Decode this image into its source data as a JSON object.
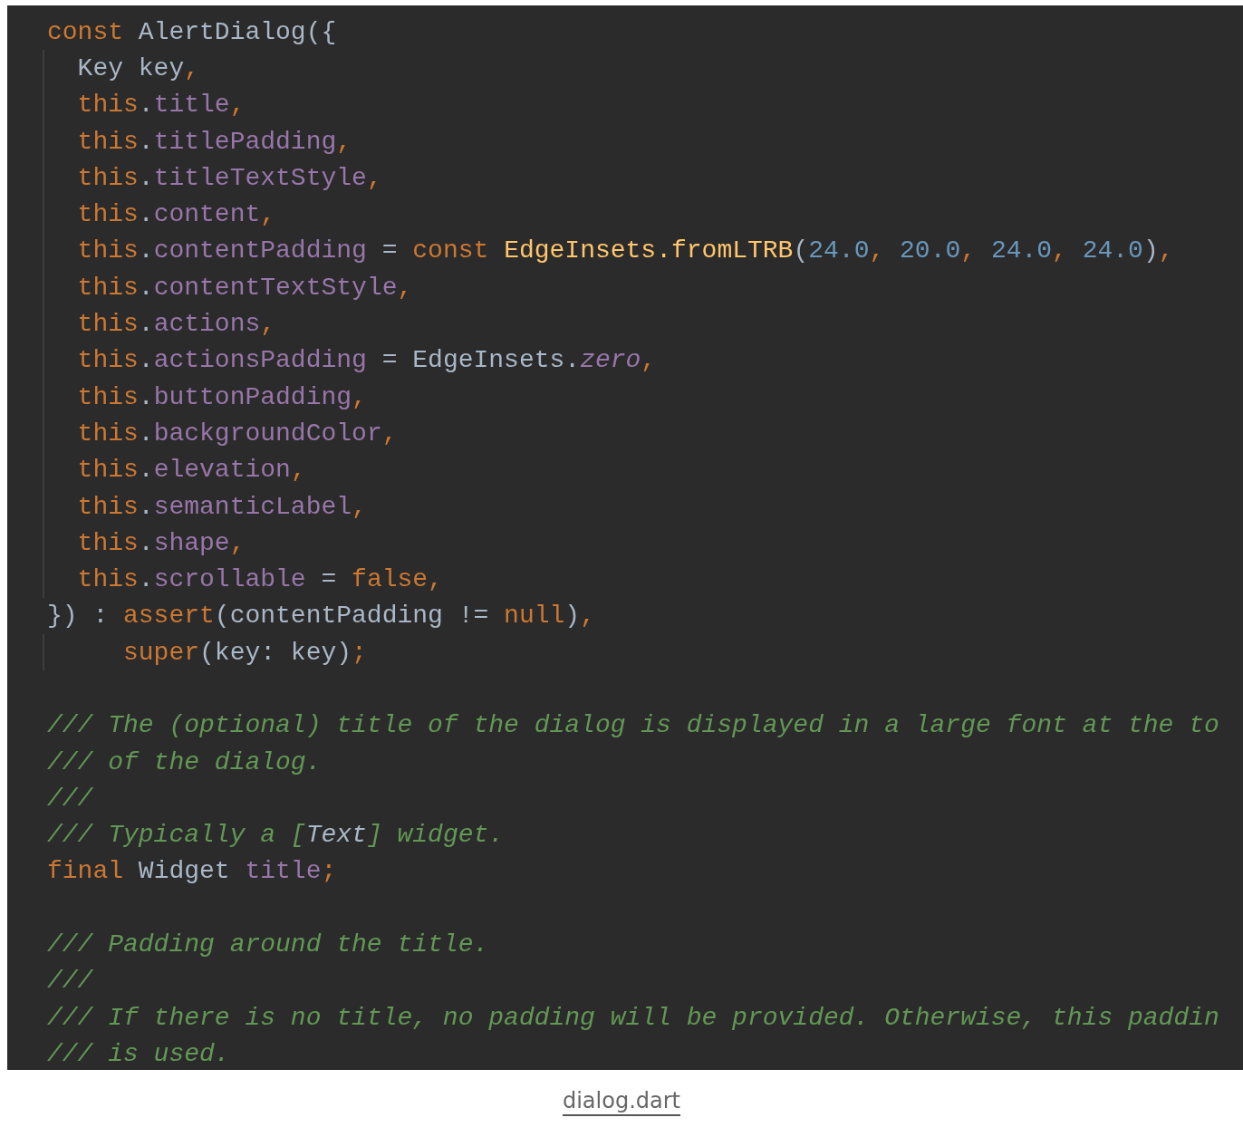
{
  "code_lines": [
    {
      "guide": false,
      "tokens": [
        {
          "kind": "keyword",
          "text": "const "
        },
        {
          "kind": "plain",
          "text": "AlertDialog({"
        }
      ]
    },
    {
      "guide": true,
      "tokens": [
        {
          "kind": "plain",
          "text": "  Key key"
        },
        {
          "kind": "keyword",
          "text": ","
        }
      ]
    },
    {
      "guide": true,
      "tokens": [
        {
          "kind": "keyword",
          "text": "  this"
        },
        {
          "kind": "plain",
          "text": "."
        },
        {
          "kind": "field",
          "text": "title"
        },
        {
          "kind": "keyword",
          "text": ","
        }
      ]
    },
    {
      "guide": true,
      "tokens": [
        {
          "kind": "keyword",
          "text": "  this"
        },
        {
          "kind": "plain",
          "text": "."
        },
        {
          "kind": "field",
          "text": "titlePadding"
        },
        {
          "kind": "keyword",
          "text": ","
        }
      ]
    },
    {
      "guide": true,
      "tokens": [
        {
          "kind": "keyword",
          "text": "  this"
        },
        {
          "kind": "plain",
          "text": "."
        },
        {
          "kind": "field",
          "text": "titleTextStyle"
        },
        {
          "kind": "keyword",
          "text": ","
        }
      ]
    },
    {
      "guide": true,
      "tokens": [
        {
          "kind": "keyword",
          "text": "  this"
        },
        {
          "kind": "plain",
          "text": "."
        },
        {
          "kind": "field",
          "text": "content"
        },
        {
          "kind": "keyword",
          "text": ","
        }
      ]
    },
    {
      "guide": true,
      "tokens": [
        {
          "kind": "keyword",
          "text": "  this"
        },
        {
          "kind": "plain",
          "text": "."
        },
        {
          "kind": "field",
          "text": "contentPadding"
        },
        {
          "kind": "plain",
          "text": " = "
        },
        {
          "kind": "keyword",
          "text": "const "
        },
        {
          "kind": "function",
          "text": "EdgeInsets.fromLTRB"
        },
        {
          "kind": "plain",
          "text": "("
        },
        {
          "kind": "number",
          "text": "24.0"
        },
        {
          "kind": "keyword",
          "text": ", "
        },
        {
          "kind": "number",
          "text": "20.0"
        },
        {
          "kind": "keyword",
          "text": ", "
        },
        {
          "kind": "number",
          "text": "24.0"
        },
        {
          "kind": "keyword",
          "text": ", "
        },
        {
          "kind": "number",
          "text": "24.0"
        },
        {
          "kind": "plain",
          "text": ")"
        },
        {
          "kind": "keyword",
          "text": ","
        }
      ]
    },
    {
      "guide": true,
      "tokens": [
        {
          "kind": "keyword",
          "text": "  this"
        },
        {
          "kind": "plain",
          "text": "."
        },
        {
          "kind": "field",
          "text": "contentTextStyle"
        },
        {
          "kind": "keyword",
          "text": ","
        }
      ]
    },
    {
      "guide": true,
      "tokens": [
        {
          "kind": "keyword",
          "text": "  this"
        },
        {
          "kind": "plain",
          "text": "."
        },
        {
          "kind": "field",
          "text": "actions"
        },
        {
          "kind": "keyword",
          "text": ","
        }
      ]
    },
    {
      "guide": true,
      "tokens": [
        {
          "kind": "keyword",
          "text": "  this"
        },
        {
          "kind": "plain",
          "text": "."
        },
        {
          "kind": "field",
          "text": "actionsPadding"
        },
        {
          "kind": "plain",
          "text": " = EdgeInsets."
        },
        {
          "kind": "static",
          "text": "zero"
        },
        {
          "kind": "keyword",
          "text": ","
        }
      ]
    },
    {
      "guide": true,
      "tokens": [
        {
          "kind": "keyword",
          "text": "  this"
        },
        {
          "kind": "plain",
          "text": "."
        },
        {
          "kind": "field",
          "text": "buttonPadding"
        },
        {
          "kind": "keyword",
          "text": ","
        }
      ]
    },
    {
      "guide": true,
      "tokens": [
        {
          "kind": "keyword",
          "text": "  this"
        },
        {
          "kind": "plain",
          "text": "."
        },
        {
          "kind": "field",
          "text": "backgroundColor"
        },
        {
          "kind": "keyword",
          "text": ","
        }
      ]
    },
    {
      "guide": true,
      "tokens": [
        {
          "kind": "keyword",
          "text": "  this"
        },
        {
          "kind": "plain",
          "text": "."
        },
        {
          "kind": "field",
          "text": "elevation"
        },
        {
          "kind": "keyword",
          "text": ","
        }
      ]
    },
    {
      "guide": true,
      "tokens": [
        {
          "kind": "keyword",
          "text": "  this"
        },
        {
          "kind": "plain",
          "text": "."
        },
        {
          "kind": "field",
          "text": "semanticLabel"
        },
        {
          "kind": "keyword",
          "text": ","
        }
      ]
    },
    {
      "guide": true,
      "tokens": [
        {
          "kind": "keyword",
          "text": "  this"
        },
        {
          "kind": "plain",
          "text": "."
        },
        {
          "kind": "field",
          "text": "shape"
        },
        {
          "kind": "keyword",
          "text": ","
        }
      ]
    },
    {
      "guide": true,
      "tokens": [
        {
          "kind": "keyword",
          "text": "  this"
        },
        {
          "kind": "plain",
          "text": "."
        },
        {
          "kind": "field",
          "text": "scrollable"
        },
        {
          "kind": "plain",
          "text": " = "
        },
        {
          "kind": "keyword",
          "text": "false,"
        }
      ]
    },
    {
      "guide": false,
      "tokens": [
        {
          "kind": "plain",
          "text": "}) : "
        },
        {
          "kind": "keyword",
          "text": "assert"
        },
        {
          "kind": "plain",
          "text": "(contentPadding != "
        },
        {
          "kind": "keyword",
          "text": "null"
        },
        {
          "kind": "plain",
          "text": ")"
        },
        {
          "kind": "keyword",
          "text": ","
        }
      ]
    },
    {
      "guide": true,
      "tokens": [
        {
          "kind": "keyword",
          "text": "     super"
        },
        {
          "kind": "plain",
          "text": "(key: key)"
        },
        {
          "kind": "keyword",
          "text": ";"
        }
      ]
    },
    {
      "guide": false
    },
    {
      "guide": false,
      "tokens": [
        {
          "kind": "comment",
          "text": "/// The (optional) title of the dialog is displayed in a large font at the to"
        }
      ]
    },
    {
      "guide": false,
      "tokens": [
        {
          "kind": "comment",
          "text": "/// of the dialog."
        }
      ]
    },
    {
      "guide": false,
      "tokens": [
        {
          "kind": "comment",
          "text": "///"
        }
      ]
    },
    {
      "guide": false,
      "tokens": [
        {
          "kind": "comment",
          "text": "/// Typically a ["
        },
        {
          "kind": "doc_ref",
          "text": "Text"
        },
        {
          "kind": "comment",
          "text": "] widget."
        }
      ]
    },
    {
      "guide": false,
      "tokens": [
        {
          "kind": "keyword",
          "text": "final "
        },
        {
          "kind": "plain",
          "text": "Widget "
        },
        {
          "kind": "field",
          "text": "title"
        },
        {
          "kind": "keyword",
          "text": ";"
        }
      ]
    },
    {
      "guide": false
    },
    {
      "guide": false,
      "tokens": [
        {
          "kind": "comment",
          "text": "/// Padding around the title."
        }
      ]
    },
    {
      "guide": false,
      "tokens": [
        {
          "kind": "comment",
          "text": "///"
        }
      ]
    },
    {
      "guide": false,
      "tokens": [
        {
          "kind": "comment",
          "text": "/// If there is no title, no padding will be provided. Otherwise, this paddin"
        }
      ]
    },
    {
      "guide": false,
      "tokens": [
        {
          "kind": "comment",
          "text": "/// is used."
        }
      ]
    }
  ],
  "caption": {
    "link": "dialog.dart"
  }
}
